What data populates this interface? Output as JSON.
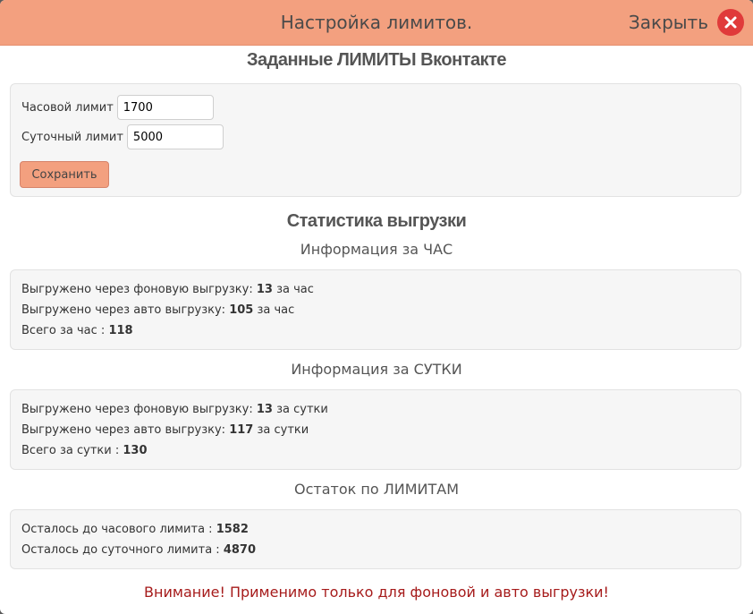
{
  "header": {
    "title": "Настройка лимитов.",
    "close_label": "Закрыть"
  },
  "limits": {
    "title": "Заданные ЛИМИТЫ Вконтакте",
    "hourly_label": "Часовой лимит",
    "hourly_value": "1700",
    "daily_label": "Суточный лимит",
    "daily_value": "5000",
    "save_label": "Сохранить"
  },
  "stats": {
    "title": "Статистика выгрузки",
    "hour": {
      "heading": "Информация за ЧАС",
      "bg_prefix": "Выгружено через фоновую выгрузку:",
      "bg_value": "13",
      "bg_suffix": "за час",
      "auto_prefix": "Выгружено через авто выгрузку:",
      "auto_value": "105",
      "auto_suffix": "за час",
      "total_prefix": "Всего за час :",
      "total_value": "118"
    },
    "day": {
      "heading": "Информация за СУТКИ",
      "bg_prefix": "Выгружено через фоновую выгрузку:",
      "bg_value": "13",
      "bg_suffix": "за сутки",
      "auto_prefix": "Выгружено через авто выгрузку:",
      "auto_value": "117",
      "auto_suffix": "за сутки",
      "total_prefix": "Всего за сутки :",
      "total_value": "130"
    },
    "remaining": {
      "heading": "Остаток по ЛИМИТАМ",
      "hourly_prefix": "Осталось до часового лимита :",
      "hourly_value": "1582",
      "daily_prefix": "Осталось до суточного лимита :",
      "daily_value": "4870"
    }
  },
  "warning": "Внимание! Применимо только для фоновой и авто выгрузки!",
  "colors": {
    "header_bg": "#f3a07f",
    "close_icon": "#e03a3a",
    "warning_text": "#a61b1b"
  }
}
